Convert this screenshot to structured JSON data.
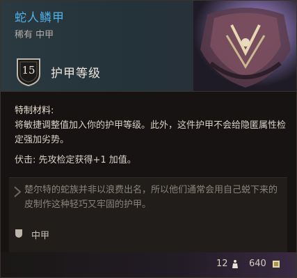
{
  "item": {
    "title": "蛇人鳞甲",
    "subtitle": "稀有 中甲",
    "armor_class": "15",
    "armor_class_label": "护甲等级"
  },
  "properties": {
    "special_heading": "特制材料:",
    "special_text": "将敏捷调整值加入你的护甲等级。此外，这件护甲不会给隐匿属性检定强加劣势。",
    "ambush": "伏击: 先攻检定获得+1 加值。"
  },
  "flavor_text": "楚尔特的蛇族并非以浪费出名，所以他们通常会用自己蜕下来的皮制作这种轻巧又牢固的护甲。",
  "armor_type": "中甲",
  "footer": {
    "weight": "12",
    "price": "640"
  },
  "colors": {
    "title": "#4fb1e6",
    "body": "#d9d1c6",
    "flavor": "#8b847b"
  },
  "icons": [
    "shield-icon",
    "quote-icon",
    "armor-type-icon",
    "weight-icon",
    "gold-icon"
  ]
}
